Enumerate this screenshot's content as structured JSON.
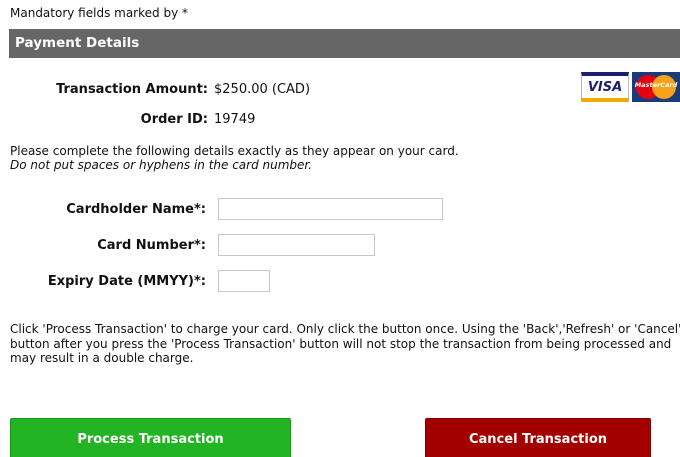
{
  "mandatory_note": "Mandatory fields marked by *",
  "section": {
    "title": "Payment Details"
  },
  "summary": {
    "amount_label": "Transaction Amount:",
    "amount_value": "$250.00 (CAD)",
    "order_label": "Order ID:",
    "order_value": "19749"
  },
  "logos": {
    "visa": "VISA",
    "mastercard": "MasterCard"
  },
  "instructions": {
    "line1": "Please complete the following details exactly as they appear on your card.",
    "line2": "Do not put spaces or hyphens in the card number."
  },
  "form": {
    "cardholder_label": "Cardholder Name*:",
    "cardholder_value": "",
    "card_number_label": "Card Number*:",
    "card_number_value": "",
    "expiry_label": "Expiry Date (MMYY)*:",
    "expiry_value": ""
  },
  "warning": "Click 'Process Transaction' to charge your card. Only click the button once. Using the 'Back','Refresh' or 'Cancel' button after you press the 'Process Transaction' button will not stop the transaction from being processed and may result in a double charge.",
  "buttons": {
    "process": "Process Transaction",
    "cancel": "Cancel Transaction"
  },
  "colors": {
    "header_bg": "#666666",
    "process_button": "#22b422",
    "cancel_button": "#a30000"
  }
}
